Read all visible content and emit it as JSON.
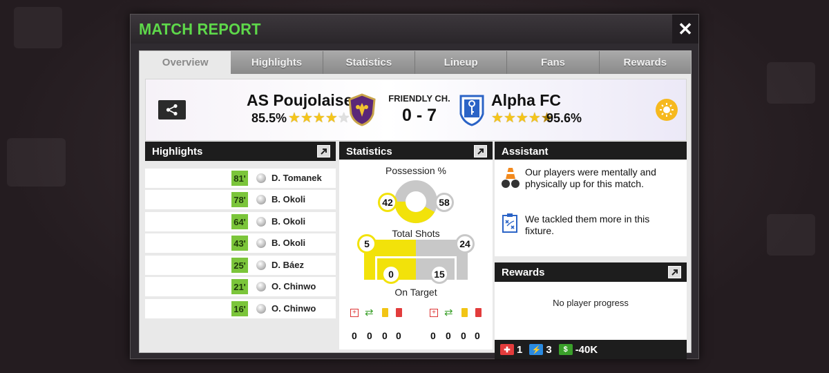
{
  "window": {
    "title": "MATCH REPORT",
    "close_label": "✕"
  },
  "tabs": [
    {
      "label": "Overview",
      "active": true
    },
    {
      "label": "Highlights",
      "active": false
    },
    {
      "label": "Statistics",
      "active": false
    },
    {
      "label": "Lineup",
      "active": false
    },
    {
      "label": "Fans",
      "active": false
    },
    {
      "label": "Rewards",
      "active": false
    }
  ],
  "match": {
    "competition": "FRIENDLY CH.",
    "score": "0 - 7",
    "home": {
      "name": "AS Poujolaise",
      "rating": "85.5%",
      "stars": 4
    },
    "away": {
      "name": "Alpha FC",
      "rating": "95.6%",
      "stars": 4.5
    },
    "weather_icon": "sun-icon"
  },
  "highlights": {
    "title": "Highlights",
    "events": [
      {
        "minute": "81'",
        "player": "D. Tomanek"
      },
      {
        "minute": "78'",
        "player": "B. Okoli"
      },
      {
        "minute": "64'",
        "player": "B. Okoli"
      },
      {
        "minute": "43'",
        "player": "B. Okoli"
      },
      {
        "minute": "25'",
        "player": "D. Báez"
      },
      {
        "minute": "21'",
        "player": "O. Chinwo"
      },
      {
        "minute": "16'",
        "player": "O. Chinwo"
      }
    ]
  },
  "statistics": {
    "title": "Statistics",
    "possession_label": "Possession %",
    "possession_home": "42",
    "possession_away": "58",
    "shots_label": "Total Shots",
    "shots_home": "5",
    "shots_away": "24",
    "on_target_label": "On Target",
    "on_target_home": "0",
    "on_target_away": "15",
    "home_cards": [
      "0",
      "0",
      "0",
      "0"
    ],
    "away_cards": [
      "0",
      "0",
      "0",
      "0"
    ],
    "colors": {
      "home": "#f2e20a",
      "away": "#c8c8c8"
    }
  },
  "assistant": {
    "title": "Assistant",
    "messages": [
      {
        "icon": "training-cones-icon",
        "text": "Our players were mentally and physically up for this match."
      },
      {
        "icon": "tactics-board-icon",
        "text": "We tackled them more in this fixture."
      }
    ]
  },
  "rewards": {
    "title": "Rewards",
    "message": "No player progress",
    "medical": "1",
    "energy": "3",
    "money": "-40K"
  }
}
